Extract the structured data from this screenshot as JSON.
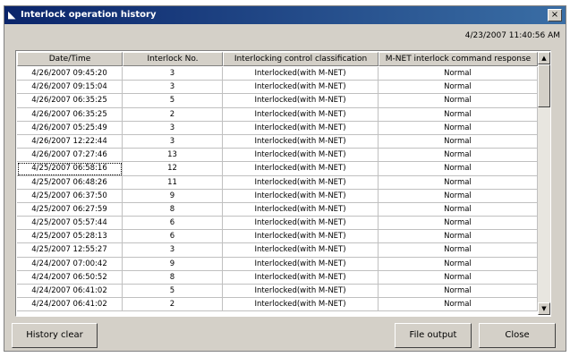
{
  "window": {
    "title": "Interlock operation history",
    "close_glyph": "×",
    "title_icon": "app-icon"
  },
  "timestamp": "4/23/2007 11:40:56 AM",
  "table": {
    "columns": [
      "Date/Time",
      "Interlock No.",
      "Interlocking control classification",
      "M-NET interlock command response"
    ],
    "rows": [
      [
        "4/26/2007 09:45:20",
        "3",
        "Interlocked(with M-NET)",
        "Normal"
      ],
      [
        "4/26/2007 09:15:04",
        "3",
        "Interlocked(with M-NET)",
        "Normal"
      ],
      [
        "4/26/2007 06:35:25",
        "5",
        "Interlocked(with M-NET)",
        "Normal"
      ],
      [
        "4/26/2007 06:35:25",
        "2",
        "Interlocked(with M-NET)",
        "Normal"
      ],
      [
        "4/26/2007 05:25:49",
        "3",
        "Interlocked(with M-NET)",
        "Normal"
      ],
      [
        "4/26/2007 12:22:44",
        "3",
        "Interlocked(with M-NET)",
        "Normal"
      ],
      [
        "4/26/2007 07:27:46",
        "13",
        "Interlocked(with M-NET)",
        "Normal"
      ],
      [
        "4/25/2007 06:58:16",
        "12",
        "Interlocked(with M-NET)",
        "Normal"
      ],
      [
        "4/25/2007 06:48:26",
        "11",
        "Interlocked(with M-NET)",
        "Normal"
      ],
      [
        "4/25/2007 06:37:50",
        "9",
        "Interlocked(with M-NET)",
        "Normal"
      ],
      [
        "4/25/2007 06:27:59",
        "8",
        "Interlocked(with M-NET)",
        "Normal"
      ],
      [
        "4/25/2007 05:57:44",
        "6",
        "Interlocked(with M-NET)",
        "Normal"
      ],
      [
        "4/25/2007 05:28:13",
        "6",
        "Interlocked(with M-NET)",
        "Normal"
      ],
      [
        "4/25/2007 12:55:27",
        "3",
        "Interlocked(with M-NET)",
        "Normal"
      ],
      [
        "4/24/2007 07:00:42",
        "9",
        "Interlocked(with M-NET)",
        "Normal"
      ],
      [
        "4/24/2007 06:50:52",
        "8",
        "Interlocked(with M-NET)",
        "Normal"
      ],
      [
        "4/24/2007 06:41:02",
        "5",
        "Interlocked(with M-NET)",
        "Normal"
      ],
      [
        "4/24/2007 06:41:02",
        "2",
        "Interlocked(with M-NET)",
        "Normal"
      ]
    ],
    "focused_row": 7
  },
  "scrollbar": {
    "up_glyph": "▲",
    "down_glyph": "▼"
  },
  "buttons": {
    "history_clear": "History clear",
    "file_output": "File output",
    "close": "Close"
  },
  "colors": {
    "titlebar_start": "#0a246a",
    "titlebar_end": "#3a6ea5",
    "face": "#d4d0c8"
  }
}
